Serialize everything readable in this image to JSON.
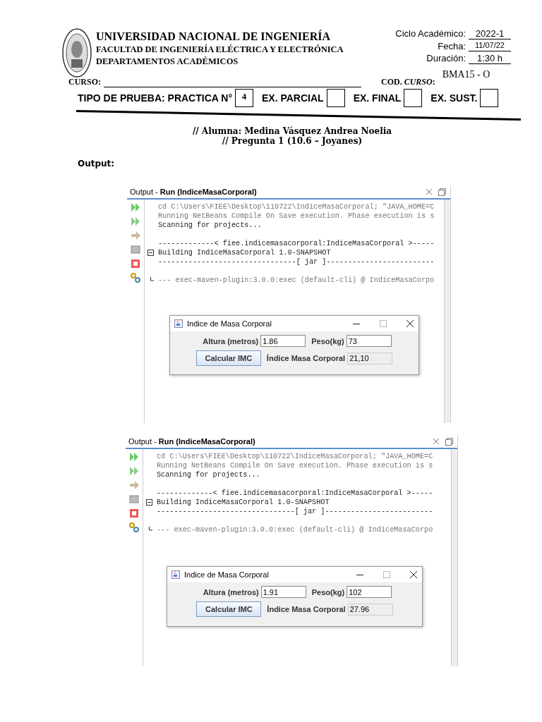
{
  "header": {
    "university": "UNIVERSIDAD NACIONAL DE INGENIERÍA",
    "faculty": "FACULTAD DE INGENIERÍA ELÉCTRICA Y ELECTRÓNICA",
    "department": "DEPARTAMENTOS ACADÉMICOS",
    "info": [
      {
        "label": "Ciclo Académico:",
        "value": "2022-1"
      },
      {
        "label": "Fecha:",
        "value": "11/07/22"
      },
      {
        "label": "Duración:",
        "value": "1:30 h"
      }
    ],
    "course_label": "CURSO:",
    "code_label": "COD. *CURSO*:",
    "code_value": "BMA15 - O"
  },
  "test_type": [
    {
      "label": "TIPO DE PRUEBA: PRACTICA N°",
      "value": "4"
    },
    {
      "label": "EX. PARCIAL",
      "checked": false
    },
    {
      "label": "EX. FINAL",
      "checked": false
    },
    {
      "label": "EX. SUST.",
      "checked": false
    }
  ],
  "student": "// Alumna: Medina Vásquez Andrea Noelia",
  "question": "// Pregunta 1 (10.6 – Joyanes)",
  "output_label": "Output:",
  "runs": [
    {
      "title": "Output - **Run (IndiceMasaCorporal)**",
      "console": [
        [
          {
            "text": "cd C:\\Users\\FIEE\\Desktop\\110722\\IndiceMasaCorporal; \"JAVA_HOME=C",
            "dim": true,
            "kind": "text"
          },
          {
            "text": "Running NetBeans Compile On Save execution. Phase execution is s",
            "dim": true,
            "kind": "text"
          },
          {
            "text": "Scanning for projects...",
            "dim": false,
            "kind": "text"
          }
        ],
        [
          {
            "text": "-------------< fiee.indicemasacorporal:IndiceMasaCorporal >-----",
            "dim": false,
            "kind": "text"
          },
          {
            "text": "Building IndiceMasaCorporal 1.0-SNAPSHOT",
            "dim": false,
            "kind": "fold"
          },
          {
            "text": "--------------------------------[ jar ]-------------------------",
            "dim": false,
            "kind": "text"
          }
        ],
        [
          {
            "text": "--- exec-maven-plugin:3.0.0:exec (default-cli) @ IndiceMasaCorpo",
            "dim": true,
            "kind": "fold-end"
          }
        ]
      ],
      "dialog": {
        "title": "Indice de Masa Corporal",
        "height_label": "Altura (metros)",
        "height_value": "1.86",
        "weight_label": "Peso(kg)",
        "weight_value": "73",
        "button": "Calcular IMC",
        "result_label": "Índice Masa Corporal",
        "result_value": "21,10"
      }
    },
    {
      "title": "Output - **Run (IndiceMasaCorporal)**",
      "console": [
        [
          {
            "text": "cd C:\\Users\\FIEE\\Desktop\\110722\\IndiceMasaCorporal; \"JAVA_HOME=C",
            "dim": true,
            "kind": "text"
          },
          {
            "text": "Running NetBeans Compile On Save execution. Phase execution is s",
            "dim": true,
            "kind": "text"
          },
          {
            "text": "Scanning for projects...",
            "dim": false,
            "kind": "text"
          }
        ],
        [
          {
            "text": "-------------< fiee.indicemasacorporal:IndiceMasaCorporal >-----",
            "dim": false,
            "kind": "text"
          },
          {
            "text": "Building IndiceMasaCorporal 1.0-SNAPSHOT",
            "dim": false,
            "kind": "fold"
          },
          {
            "text": "--------------------------------[ jar ]-------------------------",
            "dim": false,
            "kind": "text"
          }
        ],
        [
          {
            "text": "--- exec-maven-plugin:3.0.0:exec (default-cli) @ IndiceMasaCorpo",
            "dim": true,
            "kind": "fold-end"
          }
        ]
      ],
      "dialog": {
        "title": "Indice de Masa Corporal",
        "height_label": "Altura (metros)",
        "height_value": "1.91",
        "weight_label": "Peso(kg)",
        "weight_value": "102",
        "button": "Calcular IMC",
        "result_label": "Índice Masa Corporal",
        "result_value": "27.96"
      }
    }
  ]
}
